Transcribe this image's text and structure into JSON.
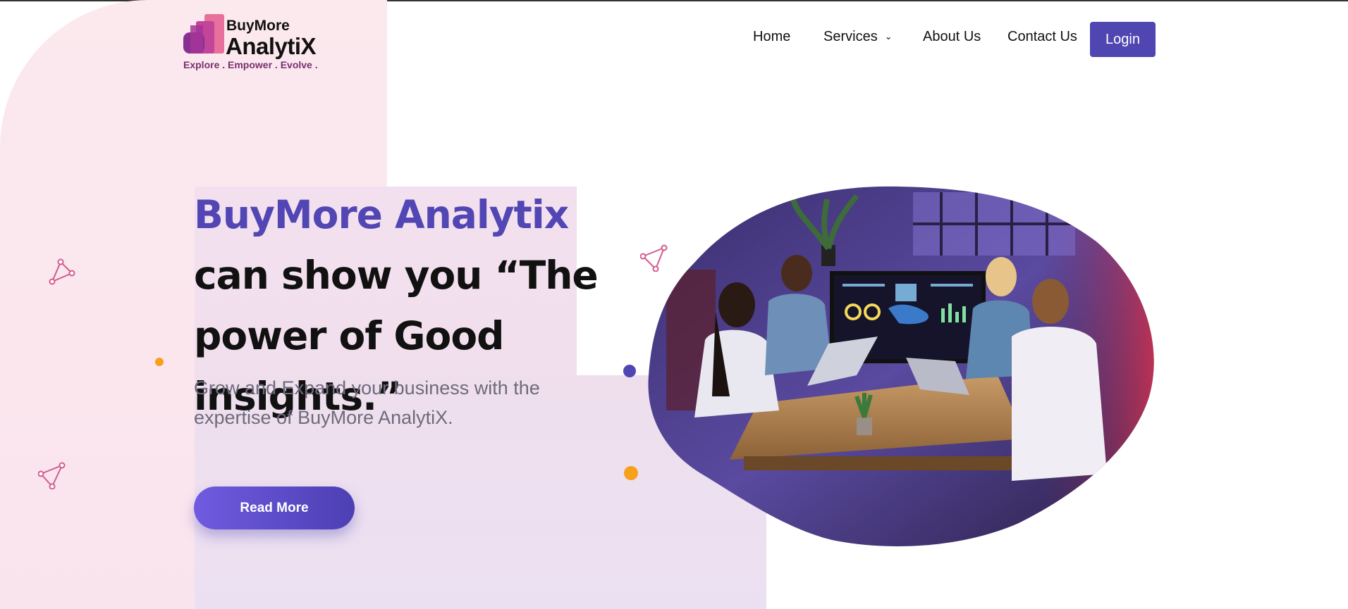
{
  "colors": {
    "brand_purple": "#5046b2",
    "headline_accent": "#5146b4",
    "orange_dot": "#f7a01a",
    "pink_background": "#fbe9ee",
    "tagline": "#7a2d6e"
  },
  "logo": {
    "top_text": "BuyMore",
    "main_text": "AnalytiX",
    "tagline": "Explore . Empower . Evolve ."
  },
  "nav": {
    "home": "Home",
    "services": "Services",
    "about": "About Us",
    "contact": "Contact Us",
    "login": "Login",
    "services_icon": "chevron-down-icon"
  },
  "hero": {
    "headline_accent": "BuyMore Analytix",
    "headline_rest": " can show you “The power of Good insights.”",
    "subtext": "Grow and Expand your business with the expertise of BuyMore AnalytiX.",
    "cta": "Read More",
    "image": {
      "icon": "team-meeting-photo"
    }
  }
}
